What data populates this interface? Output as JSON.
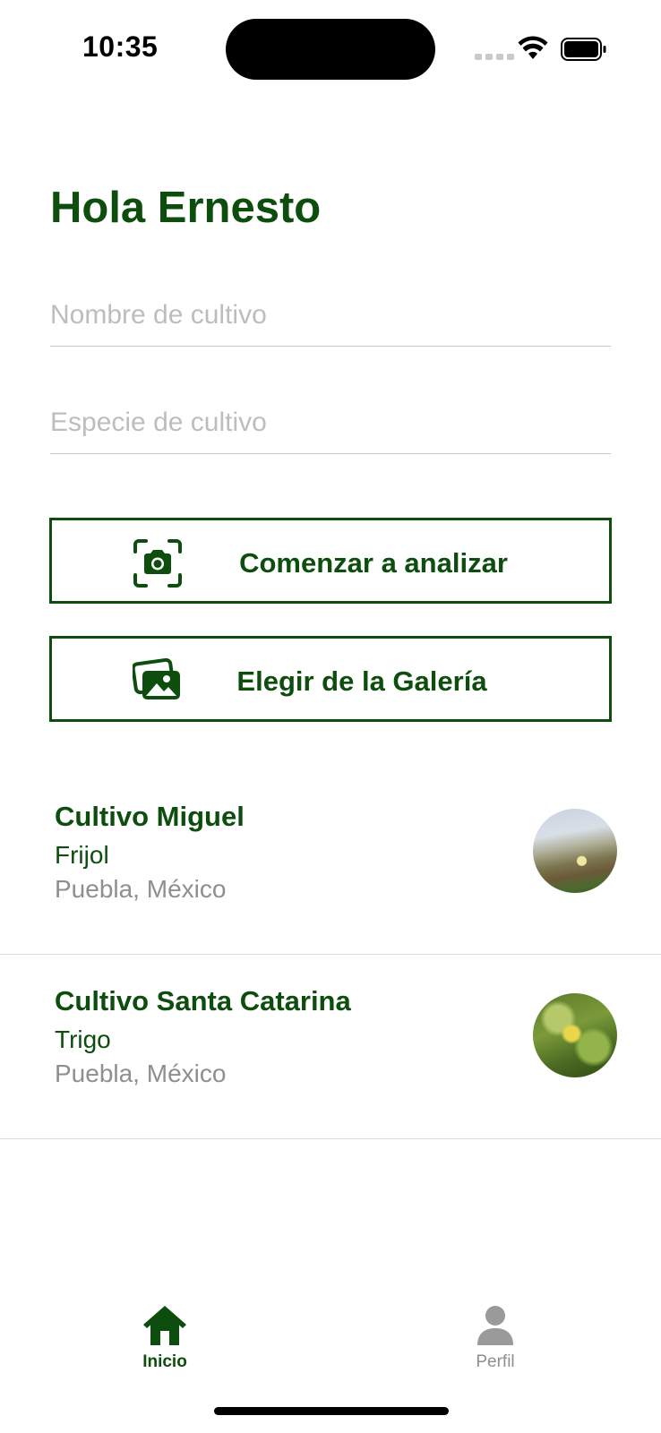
{
  "status_bar": {
    "time": "10:35",
    "icons": [
      "signal-icon",
      "wifi-icon",
      "battery-icon"
    ]
  },
  "header": {
    "greeting": "Hola Ernesto"
  },
  "form": {
    "crop_name": {
      "value": "",
      "placeholder": "Nombre de cultivo"
    },
    "crop_species": {
      "value": "",
      "placeholder": "Especie de cultivo"
    }
  },
  "actions": {
    "analyze": {
      "label": "Comenzar a analizar",
      "icon": "camera-scan-icon"
    },
    "gallery": {
      "label": "Elegir de la Galería",
      "icon": "photo-gallery-icon"
    }
  },
  "crops": [
    {
      "name": "Cultivo Miguel",
      "species": "Frijol",
      "location": "Puebla, México"
    },
    {
      "name": "Cultivo Santa Catarina",
      "species": "Trigo",
      "location": "Puebla, México"
    }
  ],
  "tab_bar": {
    "tabs": [
      {
        "label": "Inicio",
        "icon": "home-icon",
        "active": true
      },
      {
        "label": "Perfil",
        "icon": "person-icon",
        "active": false
      }
    ]
  },
  "colors": {
    "primary": "#0d4d0d",
    "secondary_text": "#8e8e93",
    "placeholder": "#bdbdbd",
    "divider": "#dcdcdc"
  }
}
